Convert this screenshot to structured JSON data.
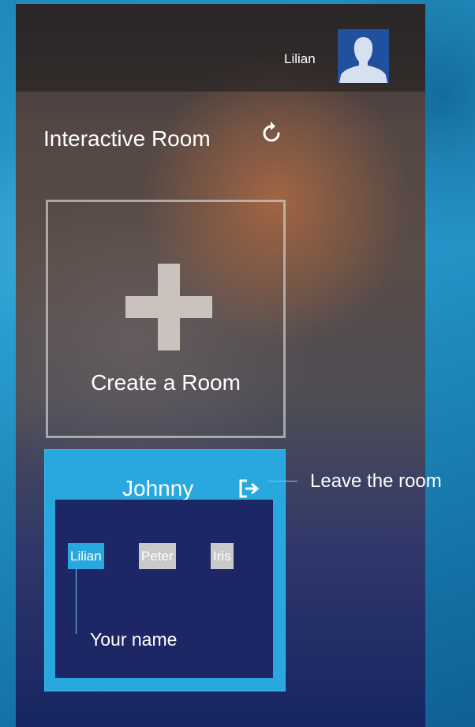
{
  "header": {
    "username": "Lilian",
    "avatar_icon": "user-silhouette-icon"
  },
  "main": {
    "title": "Interactive Room",
    "refresh_icon": "refresh-icon",
    "create_room": {
      "label": "Create a Room",
      "icon": "plus-icon"
    },
    "current_room": {
      "name": "Johnny",
      "leave_icon": "leave-room-icon",
      "members": [
        "Lilian",
        "Peter",
        "Iris"
      ],
      "highlighted_member": "Lilian"
    }
  },
  "annotations": {
    "leave": "Leave the room",
    "your_name": "Your name"
  },
  "colors": {
    "accent": "#29a8df",
    "members_panel": "#1d2766",
    "chip_inactive": "#c9c9c9"
  }
}
